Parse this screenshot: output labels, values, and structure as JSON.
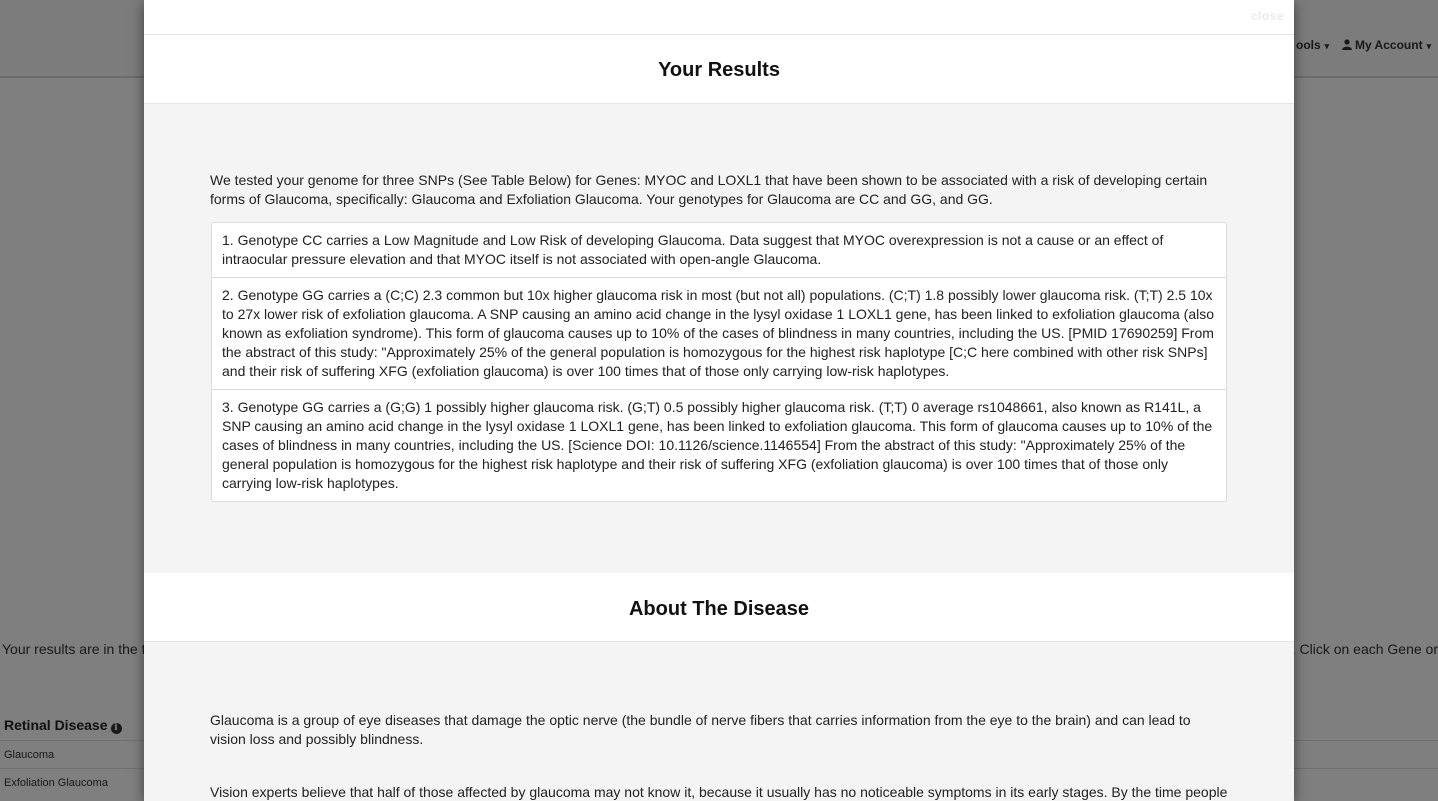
{
  "background": {
    "nav": {
      "tools_label": "ools",
      "account_label": "My Account"
    },
    "intro_left": "Your results are in the ta",
    "intro_right": ". Click on each Gene or",
    "table_header": "Retinal Disease",
    "rows": [
      "Glaucoma",
      "Exfoliation Glaucoma"
    ]
  },
  "modal": {
    "close_label": "close",
    "results": {
      "title": "Your Results",
      "summary": "We tested your genome for three SNPs (See Table Below) for Genes: MYOC and LOXL1 that have been shown to be associated with a risk of developing certain forms of Glaucoma, specifically: Glaucoma and Exfoliation Glaucoma. Your genotypes for Glaucoma are CC and GG, and GG.",
      "items": [
        "1. Genotype CC carries a Low Magnitude and Low Risk of developing Glaucoma. Data suggest that MYOC overexpression is not a cause or an effect of intraocular pressure elevation and that MYOC itself is not associated with open-angle Glaucoma.",
        "2. Genotype GG carries a (C;C) 2.3 common but 10x higher glaucoma risk in most (but not all) populations. (C;T) 1.8 possibly lower glaucoma risk. (T;T) 2.5 10x to 27x lower risk of exfoliation glaucoma. A SNP causing an amino acid change in the lysyl oxidase 1 LOXL1 gene, has been linked to exfoliation glaucoma (also known as exfoliation syndrome). This form of glaucoma causes up to 10% of the cases of blindness in many countries, including the US. [PMID 17690259] From the abstract of this study: \"Approximately 25% of the general population is homozygous for the highest risk haplotype [C;C here combined with other risk SNPs] and their risk of suffering XFG (exfoliation glaucoma) is over 100 times that of those only carrying low-risk haplotypes.",
        "3. Genotype GG carries a (G;G) 1 possibly higher glaucoma risk. (G;T) 0.5 possibly higher glaucoma risk. (T;T) 0 average rs1048661, also known as R141L, a SNP causing an amino acid change in the lysyl oxidase 1 LOXL1 gene, has been linked to exfoliation glaucoma. This form of glaucoma causes up to 10% of the cases of blindness in many countries, including the US. [Science DOI: 10.1126/science.1146554] From the abstract of this study: \"Approximately 25% of the general population is homozygous for the highest risk haplotype and their risk of suffering XFG (exfoliation glaucoma) is over 100 times that of those only carrying low-risk haplotypes."
      ]
    },
    "about": {
      "title": "About The Disease",
      "paragraph1": "Glaucoma is a group of eye diseases that damage the optic nerve (the bundle of nerve fibers that carries information from the eye to the brain) and can lead to vision loss and possibly blindness.",
      "paragraph2": "Vision experts believe that half of those affected by glaucoma may not know it, because it usually has no noticeable symptoms in its early stages. By the time people"
    }
  }
}
